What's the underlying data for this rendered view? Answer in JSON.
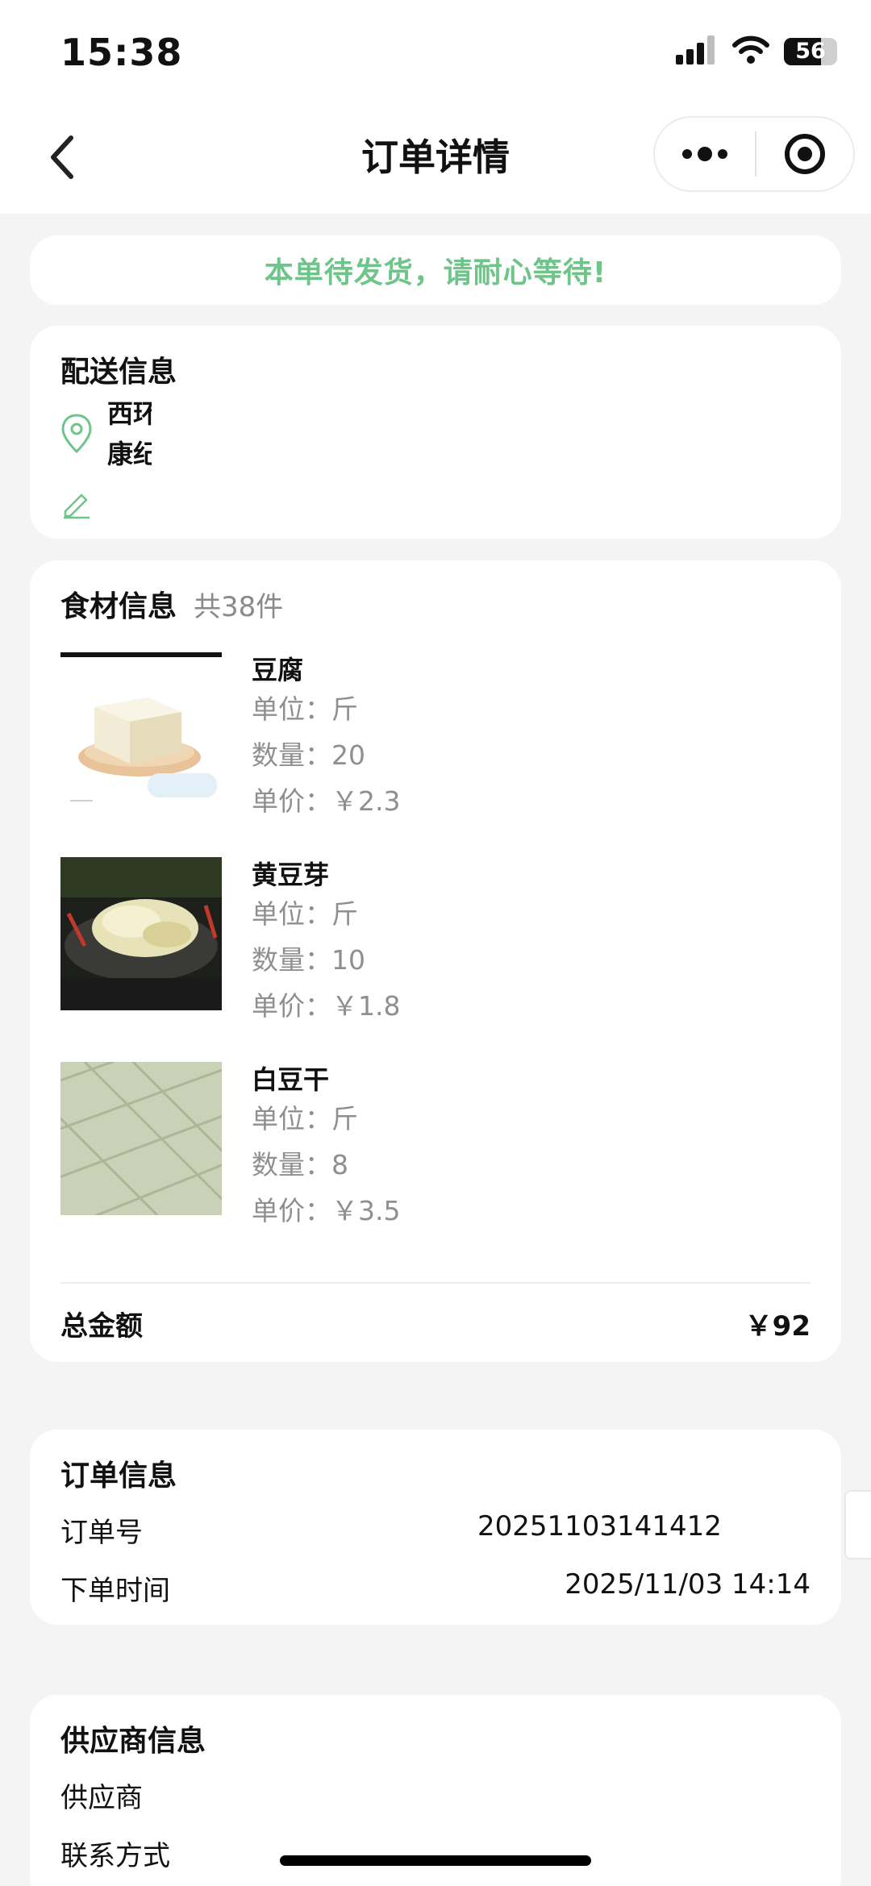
{
  "status_bar": {
    "time": "15:38",
    "battery": "56"
  },
  "nav": {
    "title": "订单详情"
  },
  "notice": {
    "text": "本单待发货，请耐心等待!"
  },
  "delivery": {
    "title": "配送信息",
    "address_line1": "西环",
    "address_line2": "康纪"
  },
  "ingredients": {
    "title": "食材信息",
    "count": "共38件",
    "items": [
      {
        "name": "豆腐",
        "unit": "单位：斤",
        "qty": "数量：20",
        "price": "单价：￥2.3",
        "image": "tofu-photo"
      },
      {
        "name": "黄豆芽",
        "unit": "单位：斤",
        "qty": "数量：10",
        "price": "单价：￥1.8",
        "image": "bean-sprouts-photo"
      },
      {
        "name": "白豆干",
        "unit": "单位：斤",
        "qty": "数量：8",
        "price": "单价：￥3.5",
        "image": "dried-tofu-photo"
      }
    ],
    "total_label": "总金额",
    "total_value": "￥92"
  },
  "order": {
    "title": "订单信息",
    "number_label": "订单号",
    "number_value": "20251103141412",
    "time_label": "下单时间",
    "time_value": "2025/11/03 14:14"
  },
  "supplier": {
    "title": "供应商信息",
    "name_label": "供应商",
    "contact_label": "联系方式"
  },
  "colors": {
    "accent_green": "#6ec489",
    "background": "#f4f4f4",
    "card": "#ffffff"
  },
  "icons": [
    "signal-icon",
    "wifi-icon",
    "battery-icon",
    "back-icon",
    "more-icon",
    "close-icon",
    "location-icon",
    "edit-icon"
  ]
}
